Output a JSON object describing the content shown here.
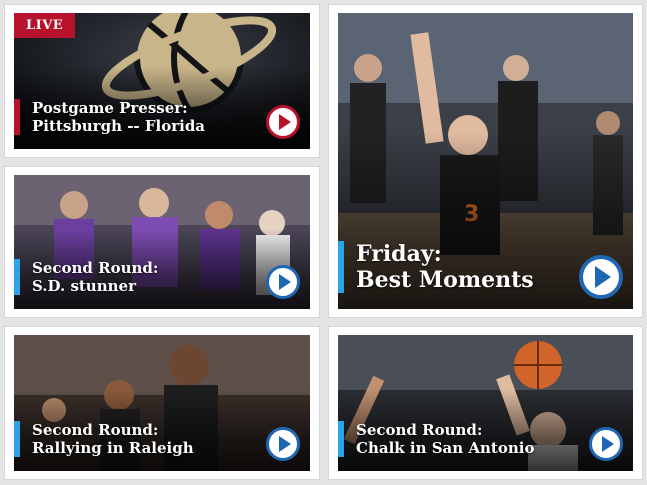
{
  "tiles": [
    {
      "badge": "LIVE",
      "line1": "Postgame Presser:",
      "line2": "Pittsburgh -- Florida"
    },
    {
      "line1": "Second Round:",
      "line2": "S.D. stunner"
    },
    {
      "line1": "Friday:",
      "line2": "Best Moments"
    },
    {
      "line1": "Second Round:",
      "line2": "Rallying in Raleigh"
    },
    {
      "line1": "Second Round:",
      "line2": "Chalk in San Antonio"
    }
  ],
  "colors": {
    "accent_red": "#b6122b",
    "accent_blue": "#2aa3e8",
    "play_blue": "#1f66b3"
  },
  "icons": {
    "play": "play-icon",
    "logo": "basketball-logo-icon"
  }
}
